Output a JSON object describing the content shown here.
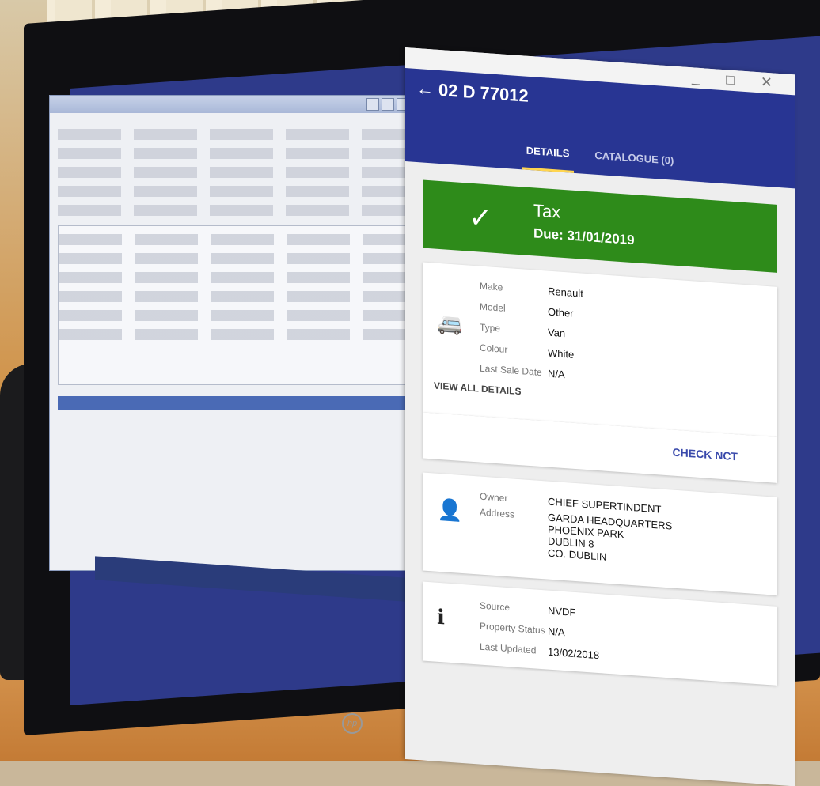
{
  "vehicle_app": {
    "window_controls": "_ □ ✕",
    "header": {
      "back_icon": "arrow-back-icon",
      "title": "02 D 77012"
    },
    "tabs": [
      {
        "label": "DETAILS",
        "active": true
      },
      {
        "label": "CATALOGUE (0)",
        "active": false
      }
    ],
    "tax": {
      "icon": "check-icon",
      "title": "Tax",
      "due": "Due: 31/01/2019",
      "color": "#2e8b1a"
    },
    "vehicle_details": {
      "icon": "car-icon",
      "fields": [
        {
          "label": "Make",
          "value": "Renault"
        },
        {
          "label": "Model",
          "value": "Other"
        },
        {
          "label": "Type",
          "value": "Van"
        },
        {
          "label": "Colour",
          "value": "White"
        },
        {
          "label": "Last Sale Date",
          "value": "N/A"
        }
      ],
      "view_all_label": "VIEW ALL DETAILS",
      "check_nct_label": "CHECK NCT"
    },
    "owner": {
      "icon": "person-icon",
      "owner_label": "Owner",
      "owner_value": "CHIEF SUPERTINDENT",
      "address_label": "Address",
      "address_lines": [
        "GARDA HEADQUARTERS",
        "PHOENIX PARK",
        "DUBLIN 8",
        "CO. DUBLIN"
      ]
    },
    "info": {
      "icon": "info-icon",
      "fields": [
        {
          "label": "Source",
          "value": "NVDF"
        },
        {
          "label": "Property Status",
          "value": "N/A"
        },
        {
          "label": "Last Updated",
          "value": "13/02/2018"
        }
      ]
    },
    "colors": {
      "app_bar": "#283593",
      "accent": "#3949ab",
      "tab_indicator": "#ffd54f"
    }
  },
  "monitor_logo": "hp"
}
